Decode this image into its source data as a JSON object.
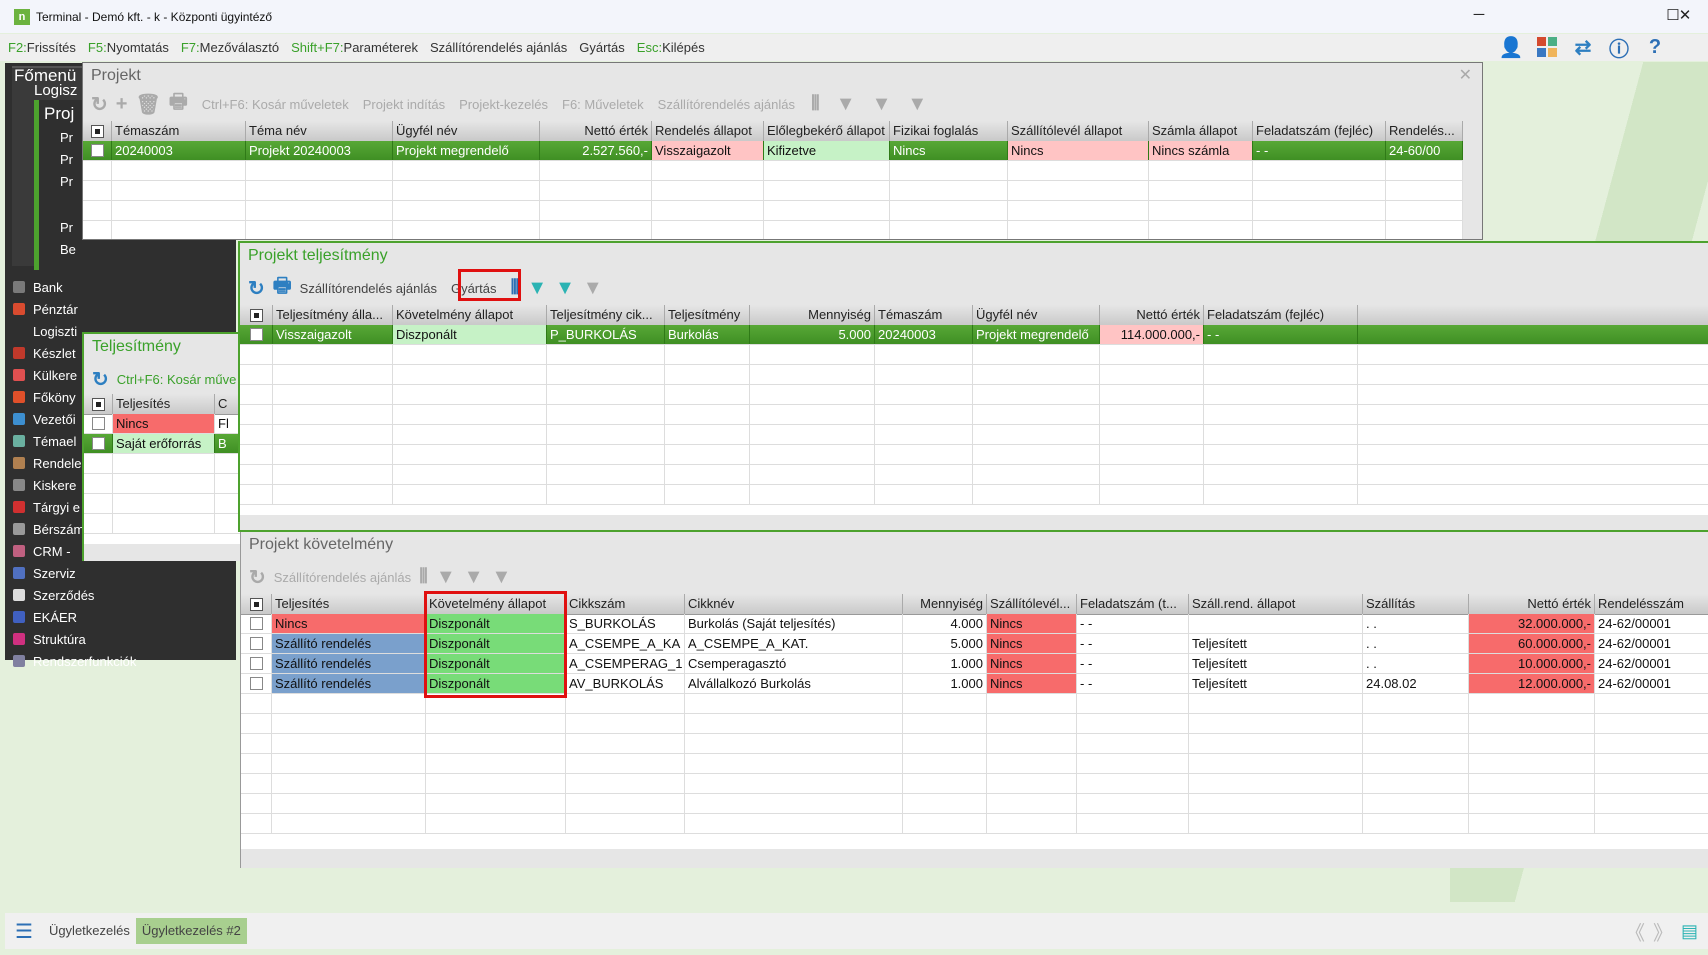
{
  "window": {
    "title": "Terminal - Demó kft. - k - Központi ügyintéző",
    "minimize": "─",
    "maximize": "☐",
    "close": "✕"
  },
  "fkeys": [
    {
      "key": "F2:",
      "label": "Frissítés"
    },
    {
      "key": "F5:",
      "label": "Nyomtatás"
    },
    {
      "key": "F7:",
      "label": "Mezőválasztó"
    },
    {
      "key": "Shift+F7:",
      "label": "Paraméterek"
    },
    {
      "key": "",
      "label": "Szállítórendelés ajánlás"
    },
    {
      "key": "",
      "label": "Gyártás"
    },
    {
      "key": "Esc:",
      "label": "Kilépés"
    }
  ],
  "top_icons": [
    "user-icon",
    "apps-grid-icon",
    "swap-arrows-icon",
    "info-icon",
    "help-icon"
  ],
  "colors": {
    "accent": "#4da22e",
    "selected_row": "#4a9c2c",
    "pink": "#ffc4c4",
    "light_green": "#c6f2c6",
    "red": "#f76b6b",
    "blue": "#7aa0cc",
    "green": "#78dc78",
    "highlight": "#e01010"
  },
  "submenu": [
    "Főmenü",
    "Logisz",
    "Proj",
    "Pr",
    "Pr",
    "Pr",
    "Pr",
    "Be"
  ],
  "sidebar": [
    {
      "label": "Bank",
      "color": "#7a7a7a"
    },
    {
      "label": "Pénztár",
      "color": "#d94b2f"
    },
    {
      "label": "Logiszti",
      "color": ""
    },
    {
      "label": "Készlet",
      "color": "#c0392b"
    },
    {
      "label": "Külkere",
      "color": "#e05050"
    },
    {
      "label": "Főköny",
      "color": "#e0502a"
    },
    {
      "label": "Vezetői",
      "color": "#3d8fd0"
    },
    {
      "label": "Témael",
      "color": "#6ab0a0"
    },
    {
      "label": "Rendele",
      "color": "#b08050"
    },
    {
      "label": "Kiskere",
      "color": "#888"
    },
    {
      "label": "Tárgyi e",
      "color": "#d03030"
    },
    {
      "label": "Bérszám",
      "color": "#999"
    },
    {
      "label": "CRM - ",
      "color": "#c06080"
    },
    {
      "label": "Szerviz",
      "color": "#5070c0"
    },
    {
      "label": "Szerződés",
      "color": "#ddd"
    },
    {
      "label": "EKÁER",
      "color": "#4060c0"
    },
    {
      "label": "Struktúra",
      "color": "#d03080"
    },
    {
      "label": "Rendszerfunkciók",
      "color": "#8080a0"
    }
  ],
  "projekt": {
    "title": "Projekt",
    "close": "✕",
    "toolbar": [
      "Ctrl+F6: Kosár műveletek",
      "Projekt indítás",
      "Projekt-kezelés",
      "F6: Műveletek",
      "Szállítórendelés ajánlás"
    ],
    "table": {
      "headers": [
        "",
        "Témaszám",
        "Téma név",
        "Ügyfél név",
        "Nettó érték",
        "Rendelés állapot",
        "Előlegbekérő állapot",
        "Fizikai foglalás",
        "Szállítólevél állapot",
        "Számla állapot",
        "Feladatszám (fejléc)",
        "Rendelés..."
      ],
      "rows": [
        {
          "selected": true,
          "cells": [
            "",
            "20240003",
            "Projekt 20240003",
            "Projekt megrendelő",
            "2.527.560,-",
            "Visszaigazolt",
            "Kifizetve",
            "Nincs",
            "Nincs",
            "Nincs számla",
            "-   -",
            "24-60/00"
          ],
          "colors": [
            null,
            null,
            null,
            null,
            null,
            "#ffc4c4",
            "#c6f2c6",
            null,
            "#ffc4c4",
            "#ffc4c4",
            null,
            null
          ]
        }
      ]
    }
  },
  "teljesitmeny": {
    "title": "Teljesítmény",
    "toolbar": "Ctrl+F6: Kosár műve",
    "table": {
      "headers": [
        "",
        "Teljesítés",
        "C"
      ],
      "rows": [
        {
          "selected": false,
          "cells": [
            "",
            "Nincs",
            "Fl"
          ],
          "colors": [
            null,
            "#f76b6b",
            null
          ]
        },
        {
          "selected": true,
          "cells": [
            "",
            "Saját erőforrás",
            "B"
          ],
          "colors": [
            null,
            "#c6f2c6",
            null
          ]
        }
      ]
    }
  },
  "projekt_teljesitmeny": {
    "title": "Projekt teljesítmény",
    "toolbar": [
      "Szállítórendelés ajánlás",
      "Gyártás"
    ],
    "table": {
      "headers": [
        "",
        "Teljesítmény álla...",
        "Követelmény állapot",
        "Teljesítmény cik...",
        "Teljesítmény",
        "Mennyiség",
        "Témaszám",
        "Ügyfél név",
        "Nettó érték",
        "Feladatszám (fejléc)",
        ""
      ],
      "rows": [
        {
          "selected": true,
          "cells": [
            "",
            "Visszaigazolt",
            "Diszponált",
            "P_BURKOLÁS",
            "Burkolás",
            "5.000",
            "20240003",
            "Projekt megrendelő",
            "114.000.000,-",
            "-   -",
            ""
          ],
          "colors": [
            null,
            null,
            "#c6f2c6",
            null,
            null,
            null,
            null,
            null,
            "#ffc4c4",
            null,
            null
          ]
        }
      ]
    }
  },
  "projekt_kovetelmeny": {
    "title": "Projekt követelmény",
    "toolbar": [
      "Szállítórendelés ajánlás"
    ],
    "table": {
      "headers": [
        "",
        "Teljesítés",
        "Követelmény állapot",
        "Cikkszám",
        "Cikknév",
        "Mennyiség",
        "Szállítólevél...",
        "Feladatszám (t...",
        "Száll.rend. állapot",
        "Szállítás",
        "Nettó érték",
        "Rendelésszám"
      ],
      "rows": [
        {
          "selected": false,
          "cells": [
            "",
            "Nincs",
            "Diszponált",
            "S_BURKOLÁS",
            "Burkolás (Saját teljesítés)",
            "4.000",
            "Nincs",
            "-   -",
            "",
            ". .",
            "32.000.000,-",
            "24-62/00001"
          ],
          "colors": [
            null,
            "#f76b6b",
            "#78dc78",
            null,
            null,
            null,
            "#f76b6b",
            null,
            null,
            null,
            "#f76b6b",
            null
          ]
        },
        {
          "selected": false,
          "cells": [
            "",
            "Szállító rendelés",
            "Diszponált",
            "A_CSEMPE_A_KA",
            "A_CSEMPE_A_KAT.",
            "5.000",
            "Nincs",
            "-   -",
            "Teljesített",
            ". .",
            "60.000.000,-",
            "24-62/00001"
          ],
          "colors": [
            null,
            "#7aa0cc",
            "#78dc78",
            null,
            null,
            null,
            "#f76b6b",
            null,
            null,
            null,
            "#f76b6b",
            null
          ]
        },
        {
          "selected": false,
          "cells": [
            "",
            "Szállító rendelés",
            "Diszponált",
            "A_CSEMPERAG_1",
            "Csemperagasztó",
            "1.000",
            "Nincs",
            "-   -",
            "Teljesített",
            ". .",
            "10.000.000,-",
            "24-62/00001"
          ],
          "colors": [
            null,
            "#7aa0cc",
            "#78dc78",
            null,
            null,
            null,
            "#f76b6b",
            null,
            null,
            null,
            "#f76b6b",
            null
          ]
        },
        {
          "selected": false,
          "cells": [
            "",
            "Szállító rendelés",
            "Diszponált",
            "AV_BURKOLÁS",
            "Alvállalkozó Burkolás",
            "1.000",
            "Nincs",
            "-   -",
            "Teljesített",
            "24.08.02",
            "12.000.000,-",
            "24-62/00001"
          ],
          "colors": [
            null,
            "#7aa0cc",
            "#78dc78",
            null,
            null,
            null,
            "#f76b6b",
            null,
            null,
            null,
            "#f76b6b",
            null
          ]
        }
      ]
    }
  },
  "bottom": {
    "tabs": [
      "Ügyletkezelés",
      "Ügyletkezelés #2"
    ],
    "active_tab": 1,
    "prev": "《",
    "next": "》"
  }
}
